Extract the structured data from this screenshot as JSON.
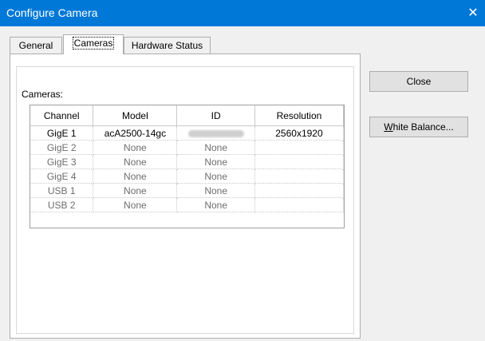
{
  "window": {
    "title": "Configure Camera",
    "close_glyph": "✕"
  },
  "tabs": [
    {
      "label": "General"
    },
    {
      "label": "Cameras"
    },
    {
      "label": "Hardware Status"
    }
  ],
  "cameras": {
    "label": "Cameras:",
    "columns": [
      "Channel",
      "Model",
      "ID",
      "Resolution"
    ],
    "rows": [
      {
        "channel": "GigE 1",
        "model": "acA2500-14gc",
        "id": "",
        "resolution": "2560x1920",
        "enabled": true
      },
      {
        "channel": "GigE 2",
        "model": "None",
        "id": "None",
        "resolution": "",
        "enabled": false
      },
      {
        "channel": "GigE 3",
        "model": "None",
        "id": "None",
        "resolution": "",
        "enabled": false
      },
      {
        "channel": "GigE 4",
        "model": "None",
        "id": "None",
        "resolution": "",
        "enabled": false
      },
      {
        "channel": "USB 1",
        "model": "None",
        "id": "None",
        "resolution": "",
        "enabled": false
      },
      {
        "channel": "USB 2",
        "model": "None",
        "id": "None",
        "resolution": "",
        "enabled": false
      }
    ]
  },
  "buttons": {
    "close_label": "Close",
    "white_balance_accel": "W",
    "white_balance_rest": "hite Balance..."
  },
  "colors": {
    "titlebar": "#0078d7",
    "disabled_text": "#6d6d6d"
  }
}
